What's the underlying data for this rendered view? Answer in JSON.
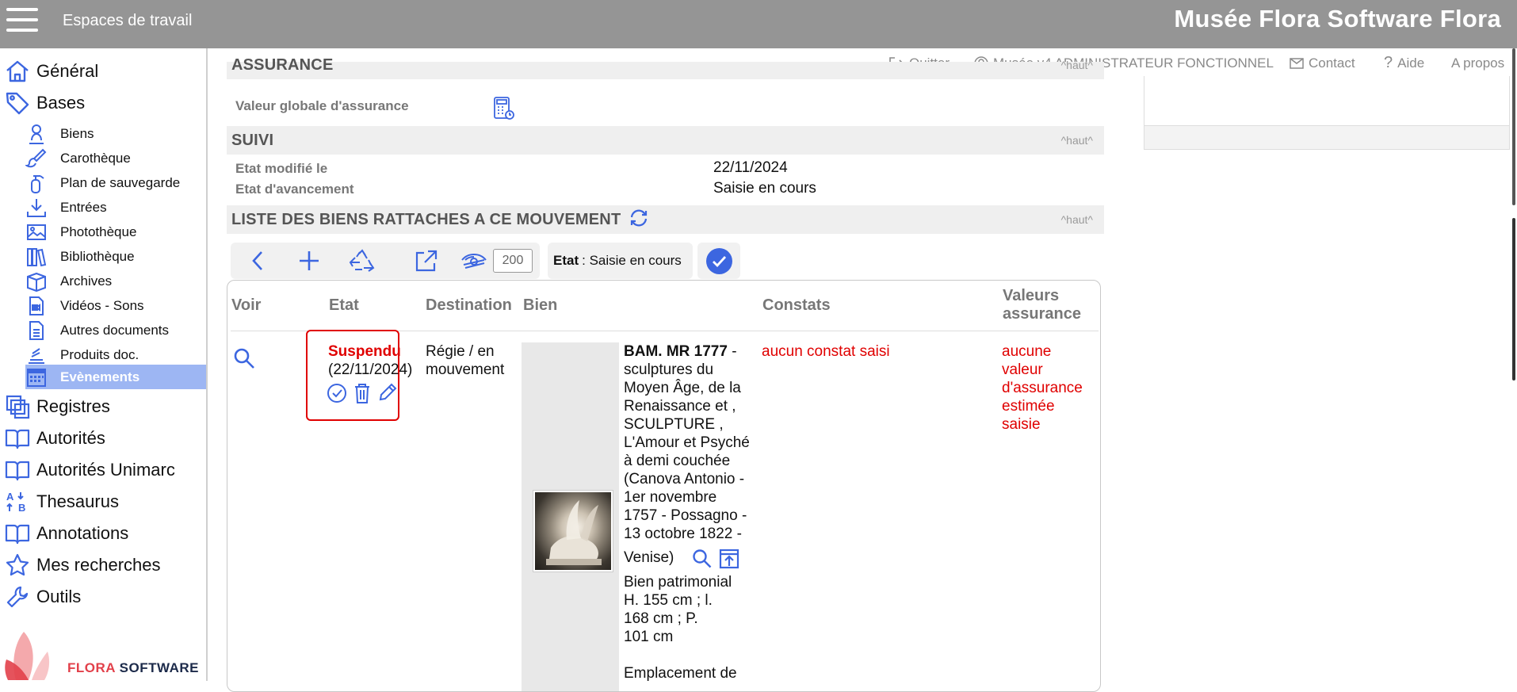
{
  "header": {
    "workspace_label": "Espaces de travail",
    "app_title": "Musée Flora Software Flora"
  },
  "utilbar": {
    "quit": "Quitter",
    "user": "Musée v4 ADMINISTRATEUR FONCTIONNEL",
    "contact": "Contact",
    "help": "Aide",
    "about": "A propos"
  },
  "sidebar": {
    "general": "Général",
    "bases": "Bases",
    "sub": {
      "biens": "Biens",
      "carotheque": "Carothèque",
      "plan": "Plan de sauvegarde",
      "entrees": "Entrées",
      "phototheque": "Photothèque",
      "bibliotheque": "Bibliothèque",
      "archives": "Archives",
      "videos": "Vidéos - Sons",
      "autres": "Autres documents",
      "produits": "Produits doc.",
      "evenements": "Evènements"
    },
    "registres": "Registres",
    "autorites": "Autorités",
    "autorites_unimarc": "Autorités Unimarc",
    "thesaurus": "Thesaurus",
    "annotations": "Annotations",
    "recherches": "Mes recherches",
    "outils": "Outils",
    "logo_text_a": "FLORA",
    "logo_text_b": "SOFTWARE"
  },
  "sections": {
    "assurance": {
      "title": "ASSURANCE",
      "haut": "^haut^",
      "valeur_label": "Valeur globale d'assurance"
    },
    "suivi": {
      "title": "SUIVI",
      "haut": "^haut^",
      "etat_modifie_label": "Etat modifié le",
      "etat_modifie_value": "22/11/2024",
      "avancement_label": "Etat d'avancement",
      "avancement_value": "Saisie en cours"
    },
    "liste": {
      "title": "LISTE DES BIENS RATTACHES A CE MOUVEMENT",
      "haut": "^haut^"
    }
  },
  "toolbar": {
    "count": "200",
    "etat_label": "Etat",
    "etat_value": " : Saisie en cours"
  },
  "table": {
    "headers": {
      "voir": "Voir",
      "etat": "Etat",
      "destination": "Destination",
      "bien": "Bien",
      "constats": "Constats",
      "valeurs_1": "Valeurs",
      "valeurs_2": "assurance"
    },
    "row": {
      "etat_status": "Suspendu",
      "etat_date": "(22/11/2024)",
      "destination_1": "Régie / en",
      "destination_2": "mouvement",
      "bien_number": "BAM. MR 1777",
      "bien_lines": [
        " -",
        "sculptures du",
        "Moyen Âge, de la",
        "Renaissance et ,",
        "SCULPTURE ,",
        "L'Amour et Psyché",
        "à demi couchée",
        "(Canova Antonio -",
        "1er novembre",
        "1757 - Possagno -",
        "13 octobre 1822 -"
      ],
      "bien_venise": "Venise)",
      "bien_type": "Bien patrimonial",
      "dims_1": "H. 155 cm ; l.",
      "dims_2": "168 cm ; P.",
      "dims_3": "101 cm",
      "emplacement": "Emplacement de",
      "constat": "aucun constat saisi",
      "valeur_lines": [
        "aucune",
        "valeur",
        "d'assurance",
        "estimée",
        "saisie"
      ]
    }
  },
  "colors": {
    "topbar": "#959595",
    "accent": "#3c66e0",
    "active_nav": "#9db6f3",
    "error": "#e00000"
  }
}
